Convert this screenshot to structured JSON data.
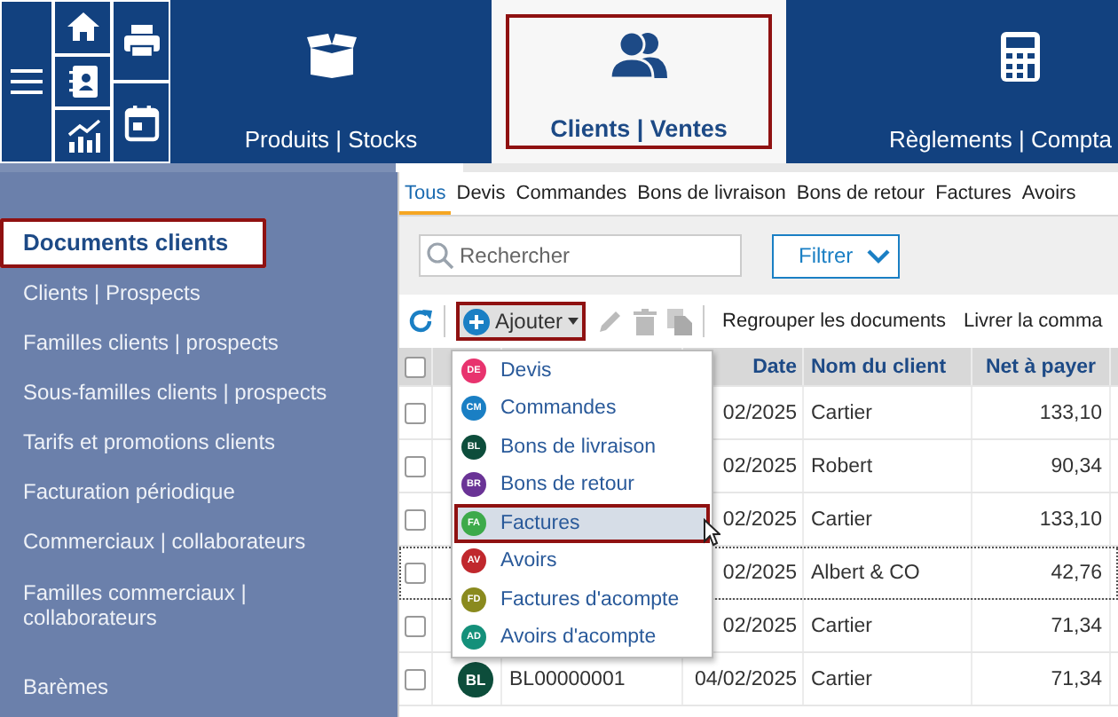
{
  "top_nav": {
    "tabs": [
      {
        "label": "Produits | Stocks",
        "kind": "box",
        "selected": false,
        "highlighted": false
      },
      {
        "label": "Clients | Ventes",
        "kind": "people",
        "selected": true,
        "highlighted": true
      },
      {
        "label": "Règlements | Compta",
        "kind": "calculator",
        "selected": false,
        "highlighted": false
      }
    ]
  },
  "sidebar": {
    "items": [
      {
        "label": "Documents clients",
        "selected": true,
        "highlighted": true
      },
      {
        "label": "Clients | Prospects",
        "selected": false,
        "highlighted": false
      },
      {
        "label": "Familles clients | prospects",
        "selected": false,
        "highlighted": false
      },
      {
        "label": "Sous-familles clients | prospects",
        "selected": false,
        "highlighted": false
      },
      {
        "label": "Tarifs et promotions clients",
        "selected": false,
        "highlighted": false
      },
      {
        "label": "Facturation périodique",
        "selected": false,
        "highlighted": false
      },
      {
        "label": "Commerciaux | collaborateurs",
        "selected": false,
        "highlighted": false
      },
      {
        "label": "Familles commerciaux | collaborateurs",
        "selected": false,
        "highlighted": false
      },
      {
        "label": "Barèmes",
        "selected": false,
        "highlighted": false
      }
    ]
  },
  "doc_tabs": [
    {
      "label": "Tous",
      "selected": true
    },
    {
      "label": "Devis",
      "selected": false
    },
    {
      "label": "Commandes",
      "selected": false
    },
    {
      "label": "Bons de livraison",
      "selected": false
    },
    {
      "label": "Bons de retour",
      "selected": false
    },
    {
      "label": "Factures",
      "selected": false
    },
    {
      "label": "Avoirs",
      "selected": false
    }
  ],
  "search": {
    "placeholder": "Rechercher"
  },
  "filter_button": {
    "label": "Filtrer"
  },
  "toolbar": {
    "add_button": {
      "label": "Ajouter",
      "highlighted": true
    },
    "actions": [
      {
        "label": "Regrouper les documents"
      },
      {
        "label": "Livrer la comma"
      }
    ]
  },
  "add_menu": {
    "items": [
      {
        "badge": "DE",
        "label": "Devis",
        "color": "#e8336e",
        "selected": false,
        "highlighted": false
      },
      {
        "badge": "CM",
        "label": "Commandes",
        "color": "#1a7fc4",
        "selected": false,
        "highlighted": false
      },
      {
        "badge": "BL",
        "label": "Bons de livraison",
        "color": "#0d4d3b",
        "selected": false,
        "highlighted": false
      },
      {
        "badge": "BR",
        "label": "Bons de retour",
        "color": "#6a3396",
        "selected": false,
        "highlighted": false
      },
      {
        "badge": "FA",
        "label": "Factures",
        "color": "#3daa4a",
        "selected": true,
        "highlighted": true
      },
      {
        "badge": "AV",
        "label": "Avoirs",
        "color": "#c0282d",
        "selected": false,
        "highlighted": false
      },
      {
        "badge": "FD",
        "label": "Factures d'acompte",
        "color": "#8a8a1e",
        "selected": false,
        "highlighted": false
      },
      {
        "badge": "AD",
        "label": "Avoirs d'acompte",
        "color": "#14907a",
        "selected": false,
        "highlighted": false
      }
    ]
  },
  "table": {
    "header_checked": false,
    "columns": [
      {
        "label": "Date"
      },
      {
        "label": "Nom du client"
      },
      {
        "label": "Net à payer"
      }
    ],
    "rows": [
      {
        "checked": false,
        "focused": false,
        "date": "02/2025",
        "client": "Cartier",
        "amount": "133,10"
      },
      {
        "checked": false,
        "focused": false,
        "date": "02/2025",
        "client": "Robert",
        "amount": "90,34"
      },
      {
        "checked": false,
        "focused": false,
        "date": "02/2025",
        "client": "Cartier",
        "amount": "133,10"
      },
      {
        "checked": false,
        "focused": true,
        "date": "02/2025",
        "client": "Albert & CO",
        "amount": "42,76"
      },
      {
        "checked": false,
        "focused": false,
        "date": "02/2025",
        "client": "Cartier",
        "amount": "71,34"
      },
      {
        "checked": false,
        "focused": false,
        "badge": "BL",
        "color": "#0d4d3b",
        "number": "BL00000001",
        "date": "04/02/2025",
        "client": "Cartier",
        "amount": "71,34"
      }
    ]
  }
}
